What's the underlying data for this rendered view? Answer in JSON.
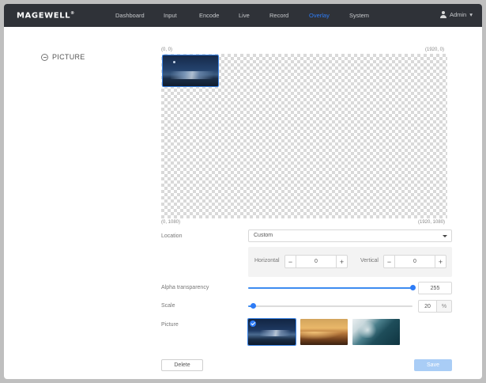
{
  "brand": {
    "logo_text": "MAGEWELL"
  },
  "nav": {
    "items": [
      {
        "label": "Dashboard",
        "active": false
      },
      {
        "label": "Input",
        "active": false
      },
      {
        "label": "Encode",
        "active": false
      },
      {
        "label": "Live",
        "active": false
      },
      {
        "label": "Record",
        "active": false
      },
      {
        "label": "Overlay",
        "active": true
      },
      {
        "label": "System",
        "active": false
      }
    ],
    "user": "Admin"
  },
  "section": {
    "title": "PICTURE"
  },
  "canvas": {
    "top_left": "(0, 0)",
    "top_right": "(1920, 0)",
    "bottom_left": "(0, 1080)",
    "bottom_right": "(1920, 1080)"
  },
  "form": {
    "location": {
      "label": "Location",
      "value": "Custom"
    },
    "horizontal": {
      "label": "Horizontal",
      "value": "0"
    },
    "vertical": {
      "label": "Vertical",
      "value": "0"
    },
    "alpha": {
      "label": "Alpha transparency",
      "value": "255",
      "fraction": 1.0
    },
    "scale": {
      "label": "Scale",
      "value": "20",
      "unit": "%",
      "fraction": 0.03
    },
    "picture": {
      "label": "Picture",
      "thumbnails": [
        {
          "name": "mountain",
          "selected": true
        },
        {
          "name": "desert",
          "selected": false
        },
        {
          "name": "ocean",
          "selected": false
        }
      ]
    }
  },
  "actions": {
    "delete_label": "Delete",
    "save_label": "Save"
  },
  "colors": {
    "accent": "#2e7cf6",
    "topbar": "#2f3238",
    "save_disabled": "#a9cdf6"
  }
}
